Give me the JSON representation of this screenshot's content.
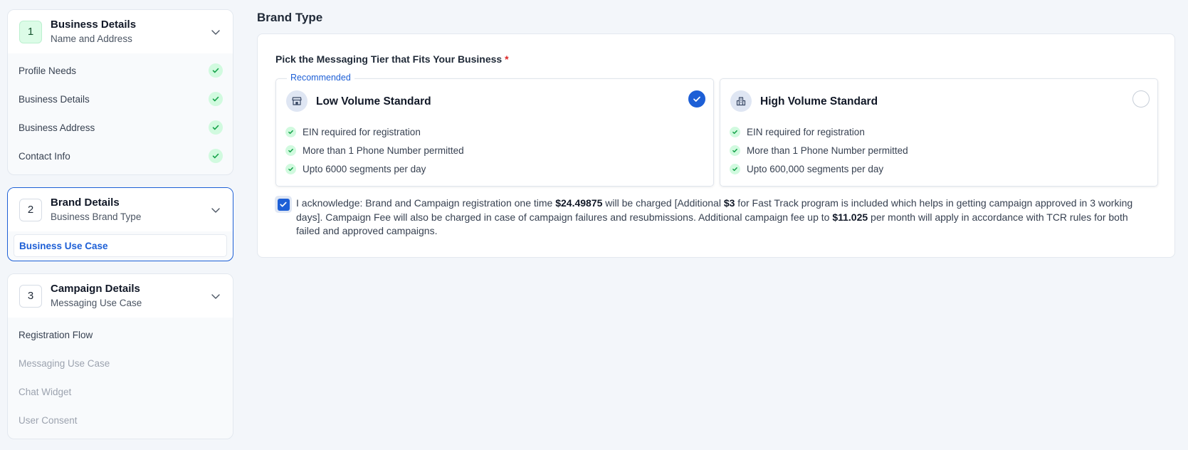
{
  "sidebar": {
    "steps": [
      {
        "number": "1",
        "title": "Business Details",
        "subtitle": "Name and Address",
        "items": [
          {
            "label": "Profile Needs",
            "status": "complete"
          },
          {
            "label": "Business Details",
            "status": "complete"
          },
          {
            "label": "Business Address",
            "status": "complete"
          },
          {
            "label": "Contact Info",
            "status": "complete"
          }
        ]
      },
      {
        "number": "2",
        "title": "Brand Details",
        "subtitle": "Business Brand Type",
        "items": [
          {
            "label": "Business Use Case",
            "status": "current"
          }
        ]
      },
      {
        "number": "3",
        "title": "Campaign Details",
        "subtitle": "Messaging Use Case",
        "items": [
          {
            "label": "Registration Flow",
            "status": "pending"
          },
          {
            "label": "Messaging Use Case",
            "status": "disabled"
          },
          {
            "label": "Chat Widget",
            "status": "disabled"
          },
          {
            "label": "User Consent",
            "status": "disabled"
          }
        ]
      }
    ]
  },
  "main": {
    "title": "Brand Type",
    "question": "Pick the Messaging Tier that Fits Your Business",
    "required_marker": "*",
    "tiers": [
      {
        "name": "Low Volume Standard",
        "tag": "Recommended",
        "icon": "store-icon",
        "selected": true,
        "features": [
          "EIN required for registration",
          "More than 1 Phone Number permitted",
          "Upto 6000 segments per day"
        ]
      },
      {
        "name": "High Volume Standard",
        "icon": "building-icon",
        "selected": false,
        "features": [
          "EIN required for registration",
          "More than 1 Phone Number permitted",
          "Upto 600,000 segments per day"
        ]
      }
    ],
    "acknowledgement": {
      "checked": true,
      "part1": "I acknowledge: Brand and Campaign registration one time ",
      "amount1": "$24.49875",
      "part2": " will be charged [Additional ",
      "amount2": "$3",
      "part3": " for Fast Track program is included which helps in getting campaign approved in 3 working days]. Campaign Fee will also be charged in case of campaign failures and resubmissions. Additional campaign fee up to ",
      "amount3": "$11.025",
      "part4": " per month will apply in accordance with TCR rules for both failed and approved campaigns."
    }
  },
  "colors": {
    "accent": "#1d5fd6",
    "success_bg": "#d1fadf",
    "success": "#16a34a",
    "required": "#dc2626"
  }
}
